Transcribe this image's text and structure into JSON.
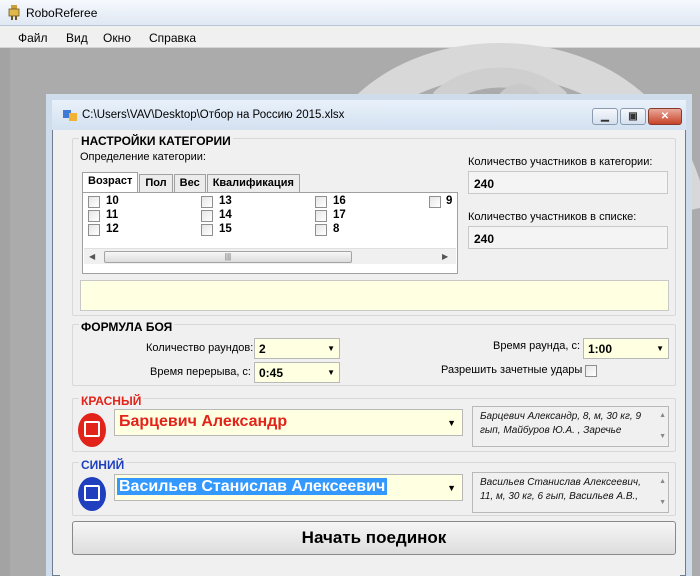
{
  "app": {
    "title": "RoboReferee"
  },
  "menu": [
    "Файл",
    "Вид",
    "Окно",
    "Справка"
  ],
  "child_window": {
    "title": "C:\\Users\\VAV\\Desktop\\Отбор на Россию 2015.xlsx"
  },
  "category": {
    "group_title": "НАСТРОЙКИ КАТЕГОРИИ",
    "definition_label": "Определение категории:",
    "tabs": [
      "Возраст",
      "Пол",
      "Вес",
      "Квалификация"
    ],
    "active_tab": "Возраст",
    "age_items": [
      "10",
      "11",
      "12",
      "13",
      "14",
      "15",
      "16",
      "17",
      "8",
      "9"
    ],
    "count_in_category_label": "Количество участников в категории:",
    "count_in_category": "240",
    "count_in_list_label": "Количество участников в списке:",
    "count_in_list": "240"
  },
  "formula": {
    "group_title": "ФОРМУЛА БОЯ",
    "rounds_label": "Количество раундов:",
    "rounds_value": "2",
    "break_label": "Время перерыва, с:",
    "break_value": "0:45",
    "round_time_label": "Время раунда, с:",
    "round_time_value": "1:00",
    "scoring_label": "Разрешить зачетные удары"
  },
  "red": {
    "label": "КРАСНЫЙ",
    "fighter": "Барцевич Александр",
    "info": "Барцевич Александр, 8, м, 30 кг, 9 гып, Майбуров Ю.А. , Заречье",
    "color": "#e2231a"
  },
  "blue": {
    "label": "СИНИЙ",
    "fighter": "Васильев Станислав Алексеевич",
    "info": "Васильев Станислав Алексеевич, 11, м, 30 кг, 6 гып, Васильев А.В.,",
    "color": "#1f3fbf"
  },
  "start_button": "Начать поединок"
}
